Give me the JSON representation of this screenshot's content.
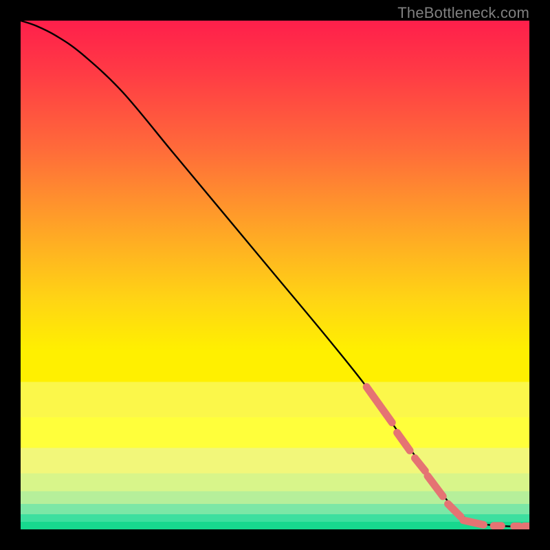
{
  "watermark": "TheBottleneck.com",
  "chart_data": {
    "type": "line",
    "title": "",
    "xlabel": "",
    "ylabel": "",
    "xlim": [
      0,
      100
    ],
    "ylim": [
      0,
      100
    ],
    "note": "Axes are unlabeled in the source image; values are normalized 0–100. y=100 is top of the colored area, y=0 is the bottom (green strip).",
    "series": [
      {
        "name": "curve",
        "x": [
          0,
          3,
          7,
          12,
          20,
          30,
          40,
          50,
          60,
          68,
          75,
          80,
          84,
          87,
          90,
          93,
          96,
          100
        ],
        "y": [
          100,
          99,
          97,
          93.5,
          86,
          74,
          62,
          50,
          38,
          28,
          18,
          11,
          5.5,
          2.5,
          1.2,
          0.8,
          0.6,
          0.6
        ]
      }
    ],
    "highlight_segments": {
      "description": "Thicker salmon-colored dot segments overlaid on the lower portion of the curve.",
      "color": "#e57373",
      "segments": [
        {
          "x0": 68,
          "y0": 28,
          "x1": 73,
          "y1": 21
        },
        {
          "x0": 74,
          "y0": 19,
          "x1": 76.5,
          "y1": 15.5
        },
        {
          "x0": 77.5,
          "y0": 14,
          "x1": 79.5,
          "y1": 11.5
        },
        {
          "x0": 80,
          "y0": 10.5,
          "x1": 83,
          "y1": 6.5
        },
        {
          "x0": 84,
          "y0": 5,
          "x1": 86.5,
          "y1": 2.5
        },
        {
          "x0": 87,
          "y0": 1.8,
          "x1": 91,
          "y1": 0.9
        },
        {
          "x0": 93,
          "y0": 0.7,
          "x1": 94.5,
          "y1": 0.7
        },
        {
          "x0": 97,
          "y0": 0.6,
          "x1": 98,
          "y1": 0.6
        },
        {
          "x0": 99,
          "y0": 0.6,
          "x1": 100,
          "y1": 0.6
        }
      ]
    },
    "background_bands": {
      "description": "Vertical color gradient from red (top / worst) through orange and yellow to green (bottom / best), typical of bottleneck heat charts.",
      "stops": [
        {
          "pct": 0,
          "color": "#ff1f4b"
        },
        {
          "pct": 25,
          "color": "#ff6a3a"
        },
        {
          "pct": 45,
          "color": "#ffb321"
        },
        {
          "pct": 65,
          "color": "#fff000"
        },
        {
          "pct": 90,
          "color": "#d8f58a"
        },
        {
          "pct": 100,
          "color": "#17d88e"
        }
      ]
    }
  }
}
